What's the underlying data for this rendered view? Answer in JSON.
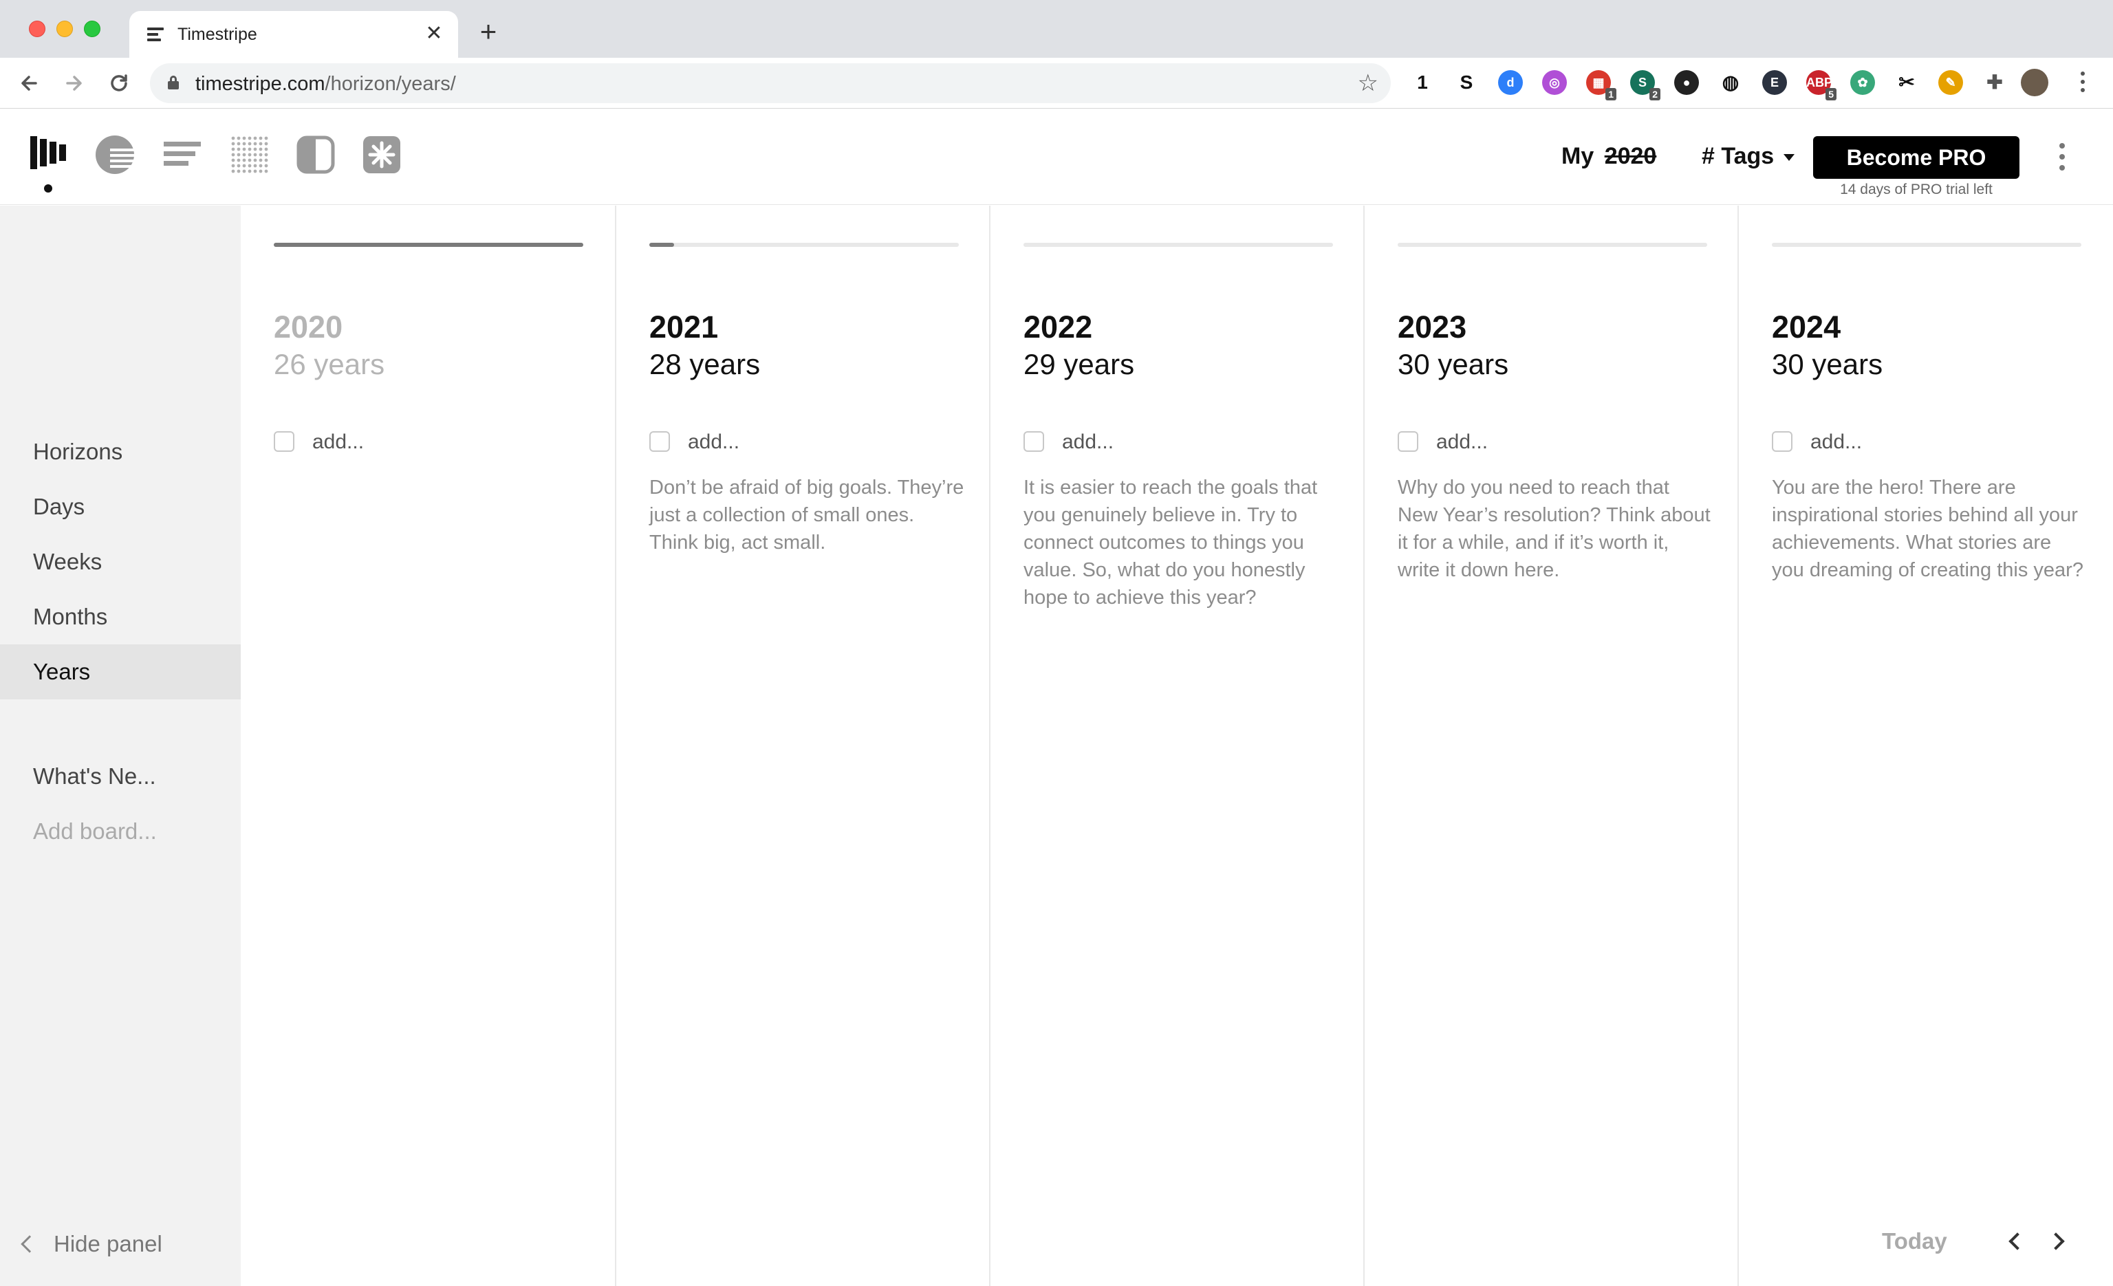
{
  "browser": {
    "tab_title": "Timestripe",
    "close_symbol": "✕",
    "newtab_symbol": "+",
    "url_domain": "timestripe.com",
    "url_path": "/horizon/years/",
    "extensions": [
      {
        "name": "1password-icon",
        "label": "1",
        "color": "#ffffff"
      },
      {
        "name": "s-extension-icon",
        "label": "S",
        "color": "#111111"
      },
      {
        "name": "d-extension-icon",
        "label": "d",
        "color": "#2d7ff9"
      },
      {
        "name": "purple-extension-icon",
        "label": "◎",
        "color": "#b04fd6"
      },
      {
        "name": "calendar-extension-icon",
        "label": "▦",
        "color": "#d9382c",
        "badge": "1"
      },
      {
        "name": "grammar-extension-icon",
        "label": "S",
        "color": "#17735b",
        "badge": "2"
      },
      {
        "name": "dark-extension-icon",
        "label": "●",
        "color": "#222222"
      },
      {
        "name": "globe-extension-icon",
        "label": "◍",
        "color": "#111111"
      },
      {
        "name": "e-extension-icon",
        "label": "E",
        "color": "#2b3240"
      },
      {
        "name": "adblock-icon",
        "label": "ABP",
        "color": "#c9232b",
        "badge": "5"
      },
      {
        "name": "green-extension-icon",
        "label": "✿",
        "color": "#38a87a"
      },
      {
        "name": "scissors-icon",
        "label": "✂",
        "color": "#111111"
      },
      {
        "name": "pen-extension-icon",
        "label": "✎",
        "color": "#e6a100"
      },
      {
        "name": "puzzle-icon",
        "label": "✚",
        "color": "#555555"
      }
    ]
  },
  "header": {
    "my_prefix": "My",
    "my_year": "2020",
    "tags_label": "# Tags",
    "pro_button": "Become PRO",
    "trial_text": "14 days of PRO trial left"
  },
  "sidebar": {
    "items": [
      {
        "label": "Horizons",
        "active": false
      },
      {
        "label": "Days",
        "active": false
      },
      {
        "label": "Weeks",
        "active": false
      },
      {
        "label": "Months",
        "active": false
      },
      {
        "label": "Years",
        "active": true
      }
    ],
    "whats_new": "What's Ne...",
    "add_board": "Add board...",
    "hide_panel": "Hide panel"
  },
  "columns": [
    {
      "year": "2020",
      "age": "26 years",
      "progress": 1.0,
      "past": true,
      "add": "add...",
      "hint": ""
    },
    {
      "year": "2021",
      "age": "28 years",
      "progress": 0.08,
      "past": false,
      "add": "add...",
      "hint": "Don’t be afraid of big goals. They’re just a collection of small ones. Think big, act small."
    },
    {
      "year": "2022",
      "age": "29 years",
      "progress": 0.0,
      "past": false,
      "add": "add...",
      "hint": "It is easier to reach the goals that you genuinely believe in. Try to connect outcomes to things you value. So, what do you honestly hope to achieve this year?"
    },
    {
      "year": "2023",
      "age": "30 years",
      "progress": 0.0,
      "past": false,
      "add": "add...",
      "hint": "Why do you need to reach that New Year’s resolution? Think about it for a while, and if it’s worth it, write it down here."
    },
    {
      "year": "2024",
      "age": "30 years",
      "progress": 0.0,
      "past": false,
      "add": "add...",
      "hint": "You are the hero! There are inspirational stories behind all your achievements. What stories are you dreaming of creating this year?"
    }
  ],
  "footer": {
    "today": "Today"
  }
}
